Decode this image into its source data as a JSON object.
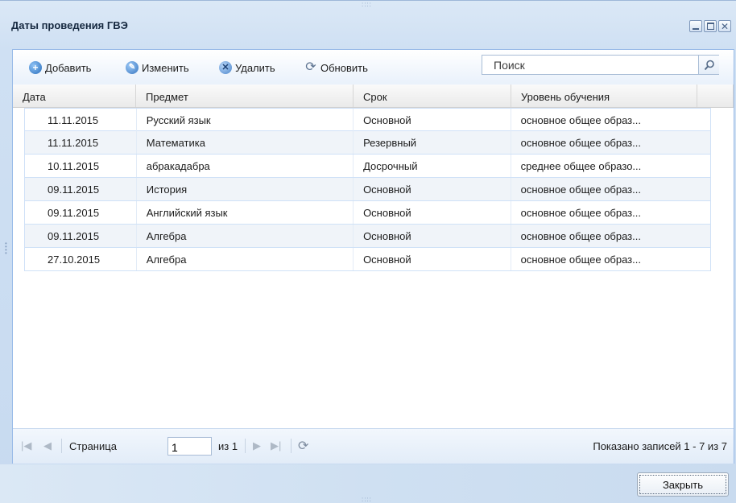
{
  "window": {
    "title": "Даты проведения ГВЭ",
    "grip": "::::"
  },
  "toolbar": {
    "add_label": "Добавить",
    "edit_label": "Изменить",
    "delete_label": "Удалить",
    "refresh_label": "Обновить",
    "search_placeholder": "Поиск"
  },
  "grid": {
    "columns": [
      "Дата",
      "Предмет",
      "Срок",
      "Уровень обучения"
    ],
    "rows": [
      [
        "11.11.2015",
        "Русский язык",
        "Основной",
        "основное общее образ..."
      ],
      [
        "11.11.2015",
        "Математика",
        "Резервный",
        "основное общее образ..."
      ],
      [
        "10.11.2015",
        "абракадабра",
        "Досрочный",
        "среднее общее образо..."
      ],
      [
        "09.11.2015",
        "История",
        "Основной",
        "основное общее образ..."
      ],
      [
        "09.11.2015",
        "Английский язык",
        "Основной",
        "основное общее образ..."
      ],
      [
        "09.11.2015",
        "Алгебра",
        "Основной",
        "основное общее образ..."
      ],
      [
        "27.10.2015",
        "Алгебра",
        "Основной",
        "основное общее образ..."
      ]
    ]
  },
  "pager": {
    "page_label": "Страница",
    "page_value": "1",
    "of_label": "из 1",
    "status": "Показано записей 1 - 7 из 7"
  },
  "footer": {
    "close_label": "Закрыть"
  },
  "icons": {
    "add": "plus-circle-icon",
    "edit": "pencil-icon",
    "delete": "x-circle-icon",
    "refresh": "refresh-icon",
    "search": "magnifier-icon"
  },
  "colors": {
    "window_bg": "#cfe0f3",
    "panel_border": "#99bbe8",
    "row_alt": "#f0f4f9",
    "accent": "#2a6fbd"
  }
}
